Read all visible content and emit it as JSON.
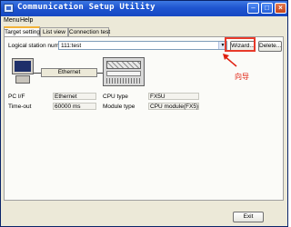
{
  "window": {
    "title": "Communication Setup Utility",
    "controls": {
      "minimize": "–",
      "maximize": "□",
      "close": "×"
    }
  },
  "menu": [
    "Menu",
    "Help"
  ],
  "tabs": [
    {
      "label": "Target setting",
      "active": true
    },
    {
      "label": "List view",
      "active": false
    },
    {
      "label": "Connection test",
      "active": false
    }
  ],
  "target": {
    "station_label": "Logical station number",
    "station_value": "111:test",
    "dropdown_glyph": "▼",
    "wizard_label": "Wizard...",
    "delete_label": "Delete..."
  },
  "annotation": {
    "callout": "向导",
    "color": "#e02010"
  },
  "diagram": {
    "connection_label": "Ethernet"
  },
  "info": {
    "pc_if_label": "PC I/F",
    "pc_if_value": "Ethernet",
    "cpu_type_label": "CPU type",
    "cpu_type_value": "FX5U",
    "timeout_label": "Time-out",
    "timeout_value": "60000 ms",
    "module_type_label": "Module type",
    "module_type_value": "CPU module(FX5)"
  },
  "footer": {
    "exit_label": "Exit"
  },
  "colors": {
    "titlebar": "#1f55d0",
    "highlight": "#e83a2a",
    "window_bg": "#ece9d8"
  }
}
